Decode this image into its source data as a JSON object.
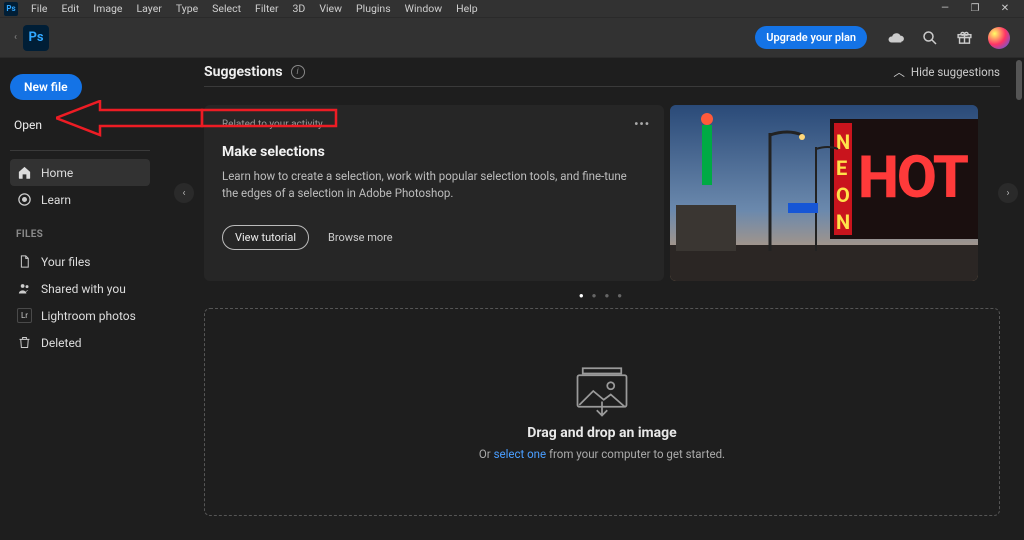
{
  "menu": [
    "File",
    "Edit",
    "Image",
    "Layer",
    "Type",
    "Select",
    "Filter",
    "3D",
    "View",
    "Plugins",
    "Window",
    "Help"
  ],
  "topbar": {
    "upgrade": "Upgrade your plan"
  },
  "sidebar": {
    "new_file": "New file",
    "open": "Open",
    "home": "Home",
    "learn": "Learn",
    "files_header": "FILES",
    "your_files": "Your files",
    "shared": "Shared with you",
    "lightroom": "Lightroom photos",
    "deleted": "Deleted"
  },
  "sugg": {
    "title": "Suggestions",
    "hide": "Hide suggestions",
    "related": "Related to your activity",
    "card_title": "Make selections",
    "card_body": "Learn how to create a selection, work with popular selection tools, and fine-tune the edges of a selection in Adobe Photoshop.",
    "view": "View tutorial",
    "browse": "Browse more"
  },
  "drop": {
    "title": "Drag and drop an image",
    "pre": "Or ",
    "link": "select one",
    "post": " from your computer to get started."
  }
}
